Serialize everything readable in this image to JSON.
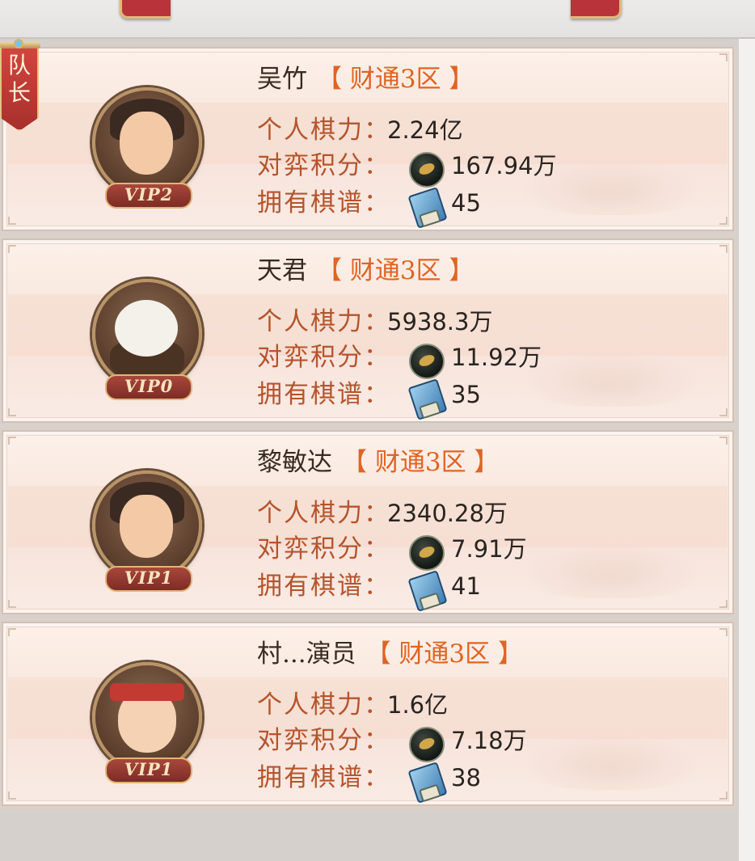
{
  "captain_badge": {
    "line1": "队",
    "line2": "长"
  },
  "members": [
    {
      "name": "吴竹",
      "server": "【 财通3区 】",
      "vip": "VIP2",
      "avatar": "male-hero-headband",
      "power_label": "个人棋力：",
      "power_value": "2.24亿",
      "score_label": "对弈积分：",
      "score_value": "167.94万",
      "manual_label": "拥有棋谱：",
      "manual_value": "45"
    },
    {
      "name": "天君",
      "server": "【 财通3区 】",
      "vip": "VIP0",
      "avatar": "eagle",
      "power_label": "个人棋力：",
      "power_value": "5938.3万",
      "score_label": "对弈积分：",
      "score_value": "11.92万",
      "manual_label": "拥有棋谱：",
      "manual_value": "35"
    },
    {
      "name": "黎敏达",
      "server": "【 财通3区 】",
      "vip": "VIP1",
      "avatar": "male-hero-bandana",
      "power_label": "个人棋力：",
      "power_value": "2340.28万",
      "score_label": "对弈积分：",
      "score_value": "7.91万",
      "manual_label": "拥有棋谱：",
      "manual_value": "41"
    },
    {
      "name": "村...演员",
      "server": "【 财通3区 】",
      "vip": "VIP1",
      "avatar": "monk",
      "power_label": "个人棋力：",
      "power_value": "1.6亿",
      "score_label": "对弈积分：",
      "score_value": "7.18万",
      "manual_label": "拥有棋谱：",
      "manual_value": "38"
    }
  ],
  "icons": {
    "score": "go-stone-icon",
    "manual": "chess-manual-book-icon"
  },
  "colors": {
    "label": "#b5542c",
    "server": "#e06422",
    "vip_bg": "#8a332c",
    "card_bg": "#f9e9e0"
  }
}
